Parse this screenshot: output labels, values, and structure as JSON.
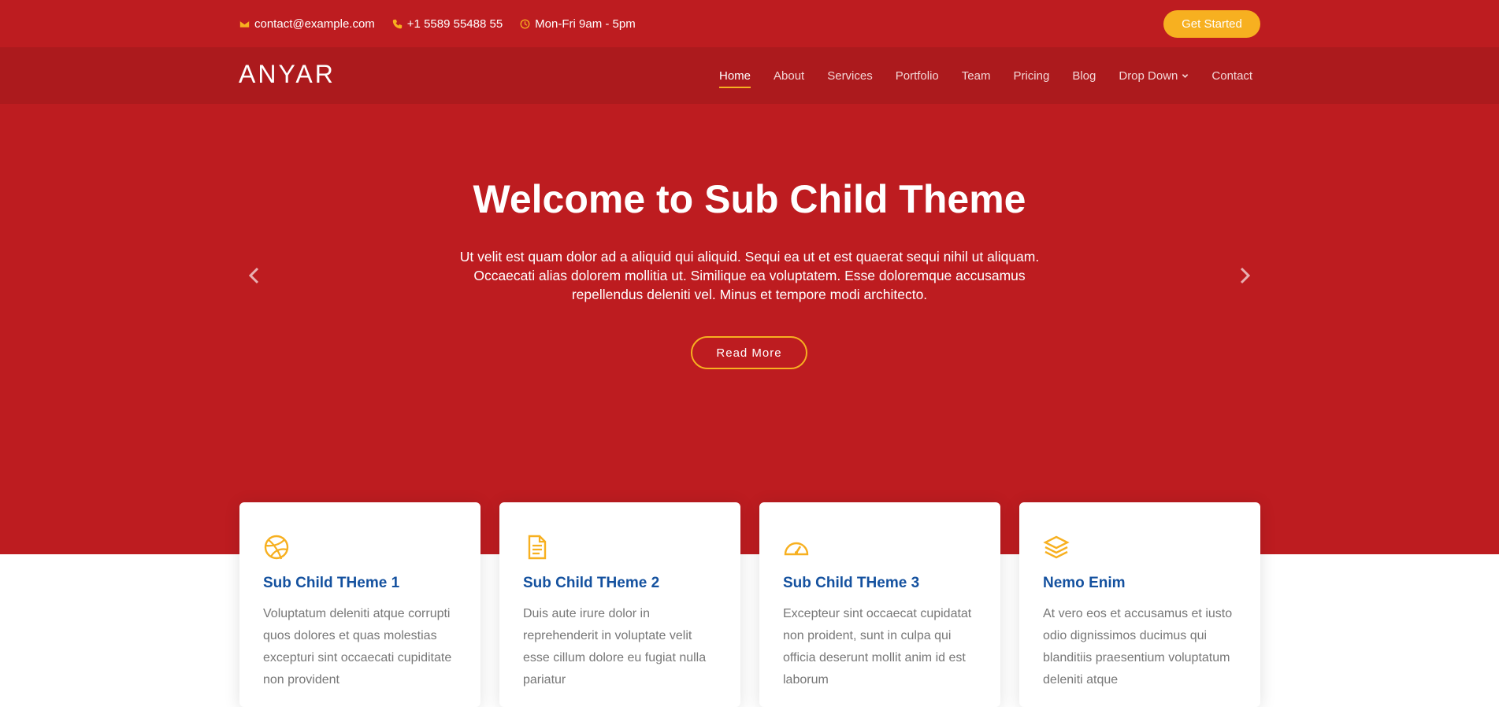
{
  "topbar": {
    "email": "contact@example.com",
    "phone": "+1 5589 55488 55",
    "hours": "Mon-Fri 9am - 5pm",
    "cta_label": "Get Started"
  },
  "navbar": {
    "logo": "ANYAR",
    "links": [
      {
        "label": "Home",
        "active": true
      },
      {
        "label": "About"
      },
      {
        "label": "Services"
      },
      {
        "label": "Portfolio"
      },
      {
        "label": "Team"
      },
      {
        "label": "Pricing"
      },
      {
        "label": "Blog"
      },
      {
        "label": "Drop Down"
      },
      {
        "label": "Contact"
      }
    ]
  },
  "hero": {
    "title": "Welcome to Sub Child Theme",
    "text": "Ut velit est quam dolor ad a aliquid qui aliquid. Sequi ea ut et est quaerat sequi nihil ut aliquam. Occaecati alias dolorem mollitia ut. Similique ea voluptatem. Esse doloremque accusamus repellendus deleniti vel. Minus et tempore modi architecto.",
    "button_label": "Read More"
  },
  "cards": [
    {
      "icon": "dribbble-icon",
      "title": "Sub Child THeme 1",
      "text": "Voluptatum deleniti atque corrupti quos dolores et quas molestias excepturi sint occaecati cupiditate non provident"
    },
    {
      "icon": "file-text-icon",
      "title": "Sub Child THeme 2",
      "text": "Duis aute irure dolor in reprehenderit in voluptate velit esse cillum dolore eu fugiat nulla pariatur"
    },
    {
      "icon": "speedometer-icon",
      "title": "Sub Child THeme 3",
      "text": "Excepteur sint occaecat cupidatat non proident, sunt in culpa qui officia deserunt mollit anim id est laborum"
    },
    {
      "icon": "layers-icon",
      "title": "Nemo Enim",
      "text": "At vero eos et accusamus et iusto odio dignissimos ducimus qui blanditiis praesentium voluptatum deleniti atque"
    }
  ],
  "colors": {
    "primary": "#bd1c20",
    "nav_bg": "#ac1a1d",
    "accent": "#f7b020",
    "card_title": "#14519f"
  }
}
